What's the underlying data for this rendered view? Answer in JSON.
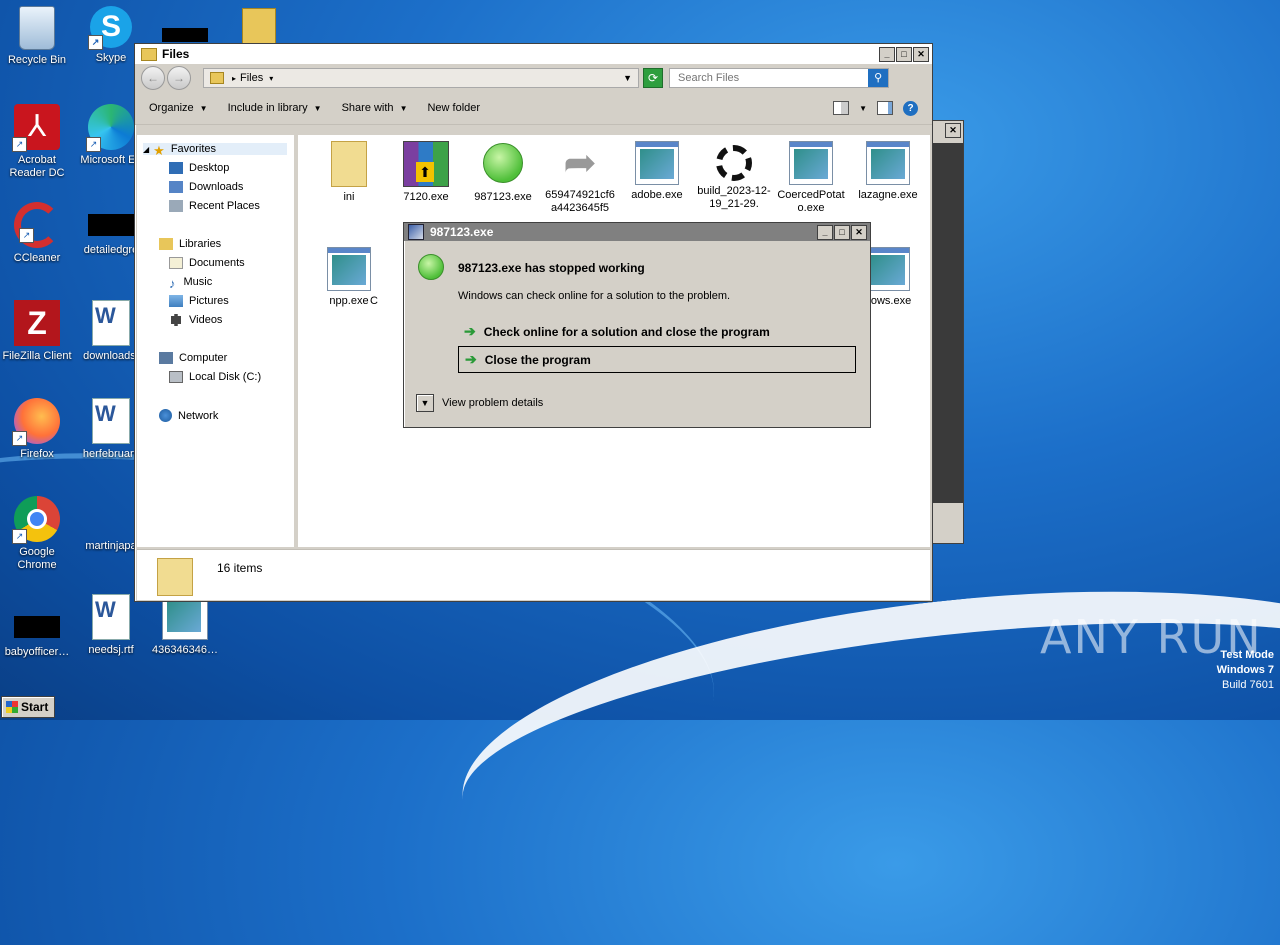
{
  "desktop": {
    "icons": [
      {
        "label": "Recycle Bin"
      },
      {
        "label": "Skype"
      },
      {
        "label": "Acrobat Reader DC"
      },
      {
        "label": "Microsoft Ed"
      },
      {
        "label": "CCleaner"
      },
      {
        "label": "detailedgre"
      },
      {
        "label": "FileZilla Client"
      },
      {
        "label": "downloads."
      },
      {
        "label": "Firefox"
      },
      {
        "label": "herfebruary"
      },
      {
        "label": "Google Chrome"
      },
      {
        "label": "martinjapa"
      },
      {
        "label": "babyofficer…"
      },
      {
        "label": "needsj.rtf"
      },
      {
        "label": "436346346…"
      }
    ]
  },
  "explorer": {
    "title": "Files",
    "address": "Files",
    "search_placeholder": "Search Files",
    "toolbar": [
      "Organize",
      "Include in library",
      "Share with",
      "New folder"
    ],
    "nav": {
      "favorites": "Favorites",
      "favorites_items": [
        "Desktop",
        "Downloads",
        "Recent Places"
      ],
      "libraries": "Libraries",
      "libraries_items": [
        "Documents",
        "Music",
        "Pictures",
        "Videos"
      ],
      "computer": "Computer",
      "computer_items": [
        "Local Disk (C:)"
      ],
      "network": "Network"
    },
    "files": [
      {
        "name": "ini"
      },
      {
        "name": "7120.exe"
      },
      {
        "name": "987123.exe"
      },
      {
        "name": "659474921cf6a4423645f5"
      },
      {
        "name": "adobe.exe"
      },
      {
        "name": "build_2023-12-19_21-29."
      },
      {
        "name": "CoercedPotato.exe"
      },
      {
        "name": "lazagne.exe"
      },
      {
        "name": "npp.exe"
      },
      {
        "name": "C"
      },
      {
        "name": "dows.exe"
      }
    ],
    "status": "16 items"
  },
  "dialog": {
    "title": "987123.exe",
    "heading": "987123.exe has stopped working",
    "message": "Windows can check online for a solution to the problem.",
    "option1": "Check online for a solution and close the program",
    "option2": "Close the program",
    "details": "View problem details"
  },
  "watermark": {
    "brand": "ANY RUN",
    "line1": "Test Mode",
    "line2": "Windows 7",
    "line3": "Build 7601"
  },
  "taskbar": {
    "start": "Start"
  }
}
